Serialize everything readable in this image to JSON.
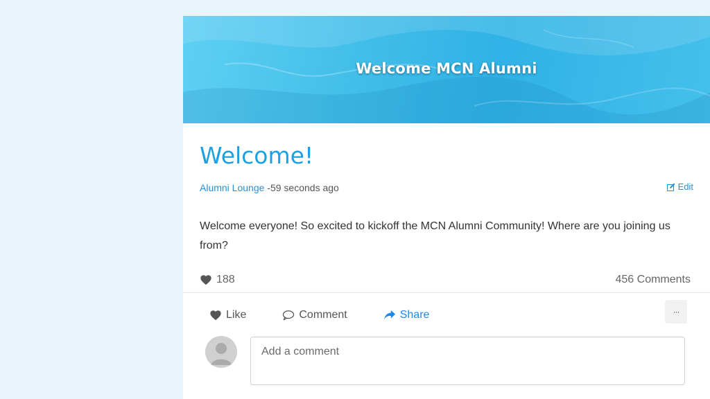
{
  "banner": {
    "title": "Welcome MCN Alumni"
  },
  "post": {
    "title": "Welcome!",
    "group": "Alumni Lounge",
    "time": "-59 seconds ago",
    "edit_label": "Edit",
    "body": "Welcome everyone! So excited to kickoff the MCN Alumni Community! Where are you joining us from?",
    "like_count": "188",
    "comment_count": "456 Comments"
  },
  "actions": {
    "like_label": "Like",
    "comment_label": "Comment",
    "share_label": "Share",
    "more_label": "···"
  },
  "comment_input": {
    "placeholder": "Add a comment",
    "value": ""
  },
  "colors": {
    "page_background": "#e9f5fb",
    "accent": "#1ba1e2",
    "link": "#2a8fd8",
    "share": "#1e88e5"
  },
  "icons": {
    "heart": "heart-icon",
    "edit": "edit-icon",
    "comment": "speech-bubble-icon",
    "share": "share-arrow-icon",
    "avatar": "user-avatar-icon"
  }
}
